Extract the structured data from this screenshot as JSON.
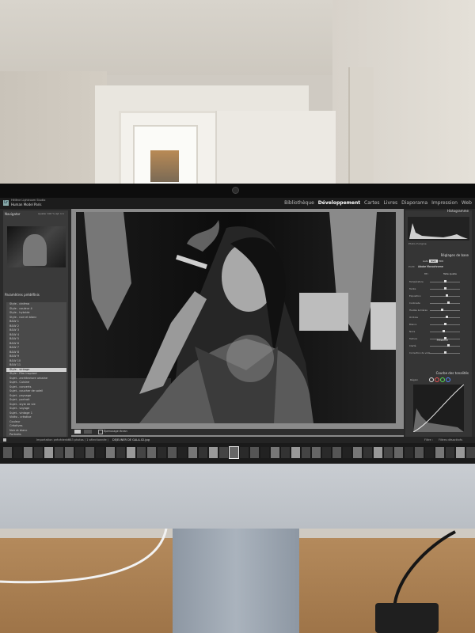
{
  "app": {
    "studio_line": "Hélène Lightroom Studio",
    "identity_plate": "Human Model Paris",
    "modules": [
      "Bibliothèque",
      "Développement",
      "Cartes",
      "Livres",
      "Diaporama",
      "Impression",
      "Web"
    ],
    "active_module": "Développement"
  },
  "left_panel": {
    "navigator_title": "Navigator",
    "navigator_zoom": [
      "Ajuster",
      "100 %",
      "Ajt. 1:1"
    ],
    "presets_title": "Paramètres prédéfinis",
    "folders": [
      "Style - cinéma",
      "Style - couleur 4",
      "Style - hybride",
      "Style - noir et blanc",
      "B&W 1",
      "B&W 2",
      "B&W 3",
      "B&W 4",
      "B&W 5",
      "B&W 6",
      "B&W 7",
      "B&W 8",
      "B&W 9",
      "B&W 10",
      "B&W 11",
      "Style - vintage",
      "Style : Film Inspired",
      "Sujet - architecture urbaine",
      "Sujet - Cuisine",
      "Sujet - concerts",
      "Sujet - coucher de soleil",
      "Sujet - paysage",
      "Sujet - portrait",
      "Sujet - style de vie",
      "Sujet - voyage",
      "Sujet - vintage 1",
      "Vidéo - créative",
      "Couleur",
      "Créatives",
      "Noir et blanc",
      "Portraits"
    ],
    "selected_folder_index": 15,
    "copy_button": "Copier...",
    "paste_button": "Coller"
  },
  "toolbar": {
    "proof_label": "Épreuvage écran"
  },
  "right_panel": {
    "histogram_title": "Histogramme",
    "histogram_info": "Photo d'origine",
    "basic_title": "Réglages de base",
    "treatment_options": [
      "Auto",
      "N&B",
      "HDR"
    ],
    "profile_label": "Profil",
    "profile_value": "Adobe Monochrome",
    "wb_label": "BB :",
    "wb_value": "Telle quelle",
    "sliders": [
      {
        "label": "Température",
        "value": 0.5
      },
      {
        "label": "Teinte",
        "value": 0.5
      },
      {
        "label": "Exposition",
        "value": 0.55
      },
      {
        "label": "Contraste",
        "value": 0.6
      },
      {
        "label": "Hautes lumières",
        "value": 0.4
      },
      {
        "label": "Ombres",
        "value": 0.55
      },
      {
        "label": "Blancs",
        "value": 0.5
      },
      {
        "label": "Noirs",
        "value": 0.45
      },
      {
        "label": "Texture",
        "value": 0.5
      },
      {
        "label": "Clarté",
        "value": 0.6
      },
      {
        "label": "Correction de voile",
        "value": 0.5
      }
    ],
    "presence_title": "Présence",
    "curve_title": "Courbe des tonalités",
    "curve_region_label": "Région",
    "previous_button": "Précédent",
    "reset_button": "Réinitialiser"
  },
  "filmstrip": {
    "source_label": "Importation précédente",
    "count_text": "383 photos / 1 sélectionnée /",
    "file_name": "DEJEUNER DE GALA-02.jpg",
    "filter_label": "Filtre :",
    "filter_value": "Filtres désactivés"
  }
}
